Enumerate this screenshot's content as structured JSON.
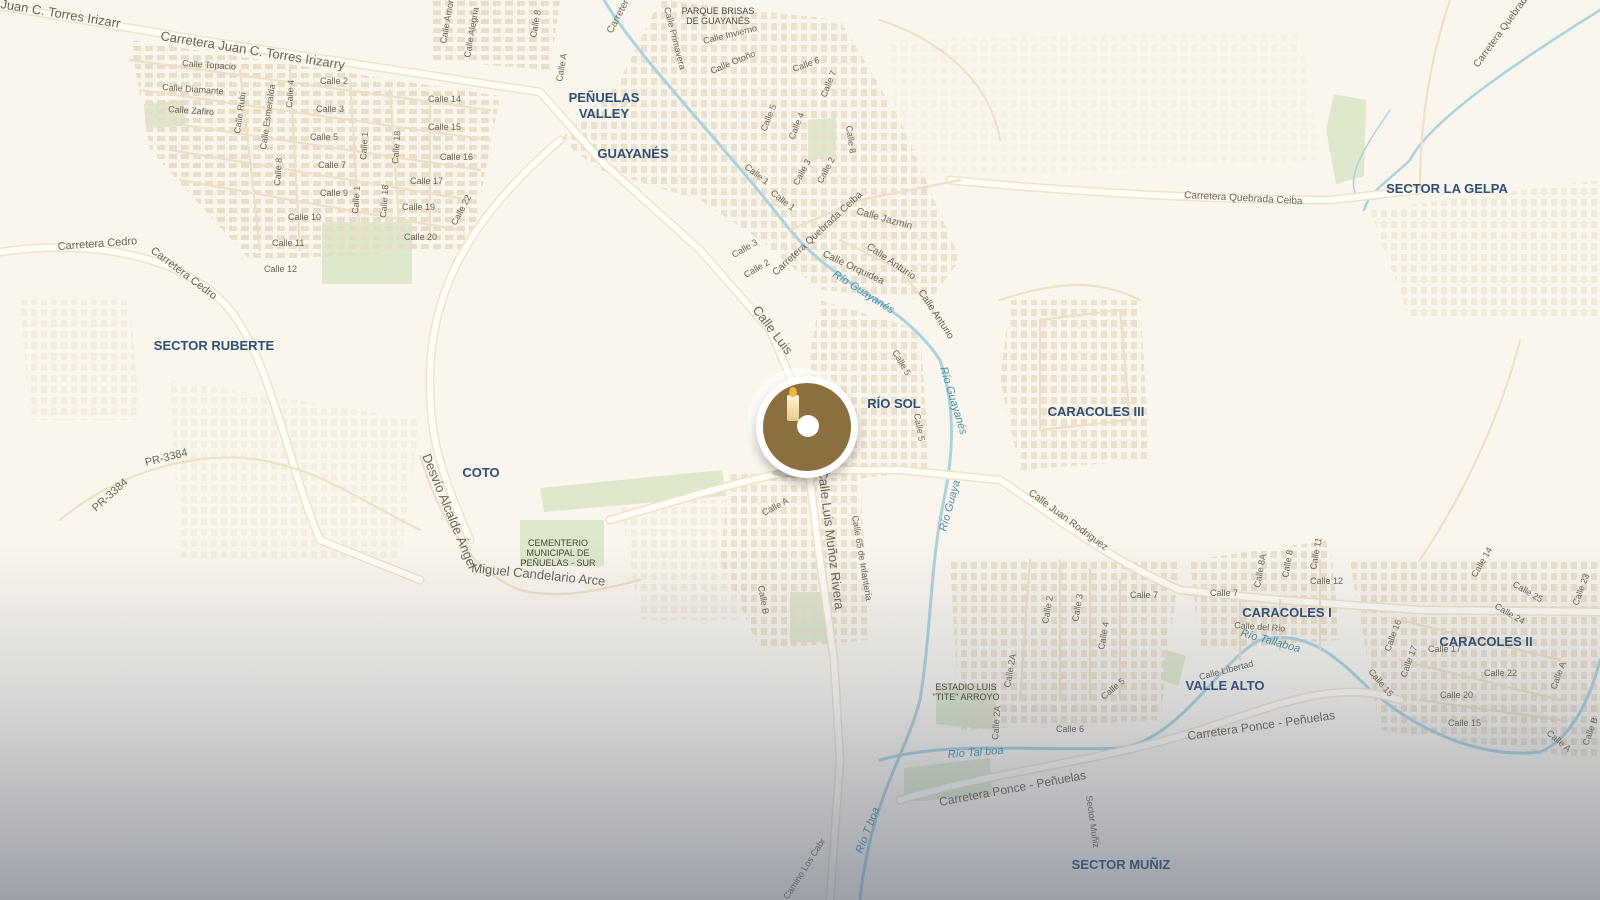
{
  "map": {
    "place_labels": [
      {
        "key": "penuelas_valley_1",
        "text": "PEÑUELAS"
      },
      {
        "key": "penuelas_valley_2",
        "text": "VALLEY"
      },
      {
        "key": "guayanes",
        "text": "GUAYANÉS"
      },
      {
        "key": "sector_ruberte",
        "text": "SECTOR RUBERTE"
      },
      {
        "key": "coto",
        "text": "COTO"
      },
      {
        "key": "rio_sol",
        "text": "RÍO SOL"
      },
      {
        "key": "caracoles_iii",
        "text": "CARACOLES III"
      },
      {
        "key": "sector_la_gelpa",
        "text": "SECTOR LA GELPA"
      },
      {
        "key": "caracoles_i",
        "text": "CARACOLES I"
      },
      {
        "key": "caracoles_ii",
        "text": "CARACOLES II"
      },
      {
        "key": "valle_alto",
        "text": "VALLE ALTO"
      },
      {
        "key": "sector_muniz",
        "text": "SECTOR MUÑIZ"
      }
    ],
    "poi_labels": {
      "parque_1": "PARQUE BRISAS",
      "parque_2": "DE GUAYANÉS",
      "cementerio_1": "CEMENTERIO",
      "cementerio_2": "MUNICIPAL DE",
      "cementerio_3": "PEÑUELAS - SUR",
      "estadio_1": "ESTADIO LUIS",
      "estadio_2": "\"TITE\" ARROYO"
    },
    "road_labels": {
      "torres_left": "Juan C. Torres Irizarry",
      "torres": "Carretera Juan C. Torres Irizarry",
      "cedro1": "Carretera Cedro",
      "cedro2": "Carretera Cedro",
      "pr3384a": "PR-3384",
      "pr3384b": "PR-3384",
      "desvio": "Desvío Alcalde Ángel Miguel Candelario Arce",
      "munoz_top": "Calle Luis M",
      "munoz": "Calle Luis Muñoz Rivera",
      "infanteria": "Calle 65 de Infantería",
      "quebrada_ceiba": "Carretera Quebrada Ceiba",
      "quebrada_ceiba2": "Carretera Quebrada Ceiba",
      "quebrada_ne": "Carretera Quebrada",
      "jazmin": "Calle Jazmin",
      "anturio": "Calle Anturio",
      "anturio2": "Calle Anturio",
      "orquidea": "Calle Orquidea",
      "primavera": "Calle Primavera",
      "invierno": "Calle Invierno",
      "otono": "Calle Otoño",
      "juan_rodriguez": "Calle Juan Rodriguez",
      "ponce1": "Carretera Ponce - Peñuelas",
      "ponce2": "Carretera Ponce - Peñuelas",
      "libertad": "Calle Libertad",
      "del_rio": "Calle del Rio",
      "los_cabros": "Camino Los Cabros",
      "sector_muniz_rd": "Sector Muñiz",
      "carretera_top": "Carretera",
      "topacio": "Calle Topacio",
      "diamante": "Calle Diamante",
      "zafiro": "Calle Zafiro",
      "rubi": "Calle Rubí",
      "esmeralda": "Calle Esmeralda",
      "c2": "Calle 2",
      "c3": "Calle 3",
      "c5": "Calle 5",
      "c7": "Calle 7",
      "c9": "Calle 9",
      "c10": "Calle 10",
      "c11": "Calle 11",
      "c12": "Calle 12",
      "c14": "Calle 14",
      "c15": "Calle 15",
      "c16": "Calle 16",
      "c17": "Calle 17",
      "c19": "Calle 19",
      "c20": "Calle 20",
      "c22": "Calle 22",
      "c18": "Calle 18",
      "c1": "Calle 1",
      "c4": "Calle 4",
      "c6": "Calle 6",
      "c8": "Calle 8",
      "amor": "Calle Amor",
      "alegria": "Calle Alegría",
      "cA": "Calle A",
      "cB": "Calle B",
      "cA2": "Calle A",
      "c6n": "Calle 6",
      "c7n": "Calle 7",
      "c5n": "Calle 5",
      "c4n": "Calle 4",
      "c3n": "Calle 3",
      "c2n": "Calle 2",
      "c1n": "Calle 1",
      "c8n": "Calle 8",
      "c3w": "Calle 3",
      "c2w": "Calle 2",
      "c5s": "Calle 5",
      "c5r": "Calle 5",
      "c2car": "Calle 2",
      "c3car": "Calle 3",
      "c4car": "Calle 4",
      "c5car": "Calle 5",
      "c6car": "Calle 6",
      "c2a": "Calle 2A",
      "c2a2": "Calle 2A",
      "c7car": "Calle 7",
      "c7car2": "Calle 7",
      "c8a": "Calle 8A",
      "c8car": "Calle 8",
      "c11car": "Calle 11",
      "c12car": "Calle 12",
      "c14e": "Calle 14",
      "c25e": "Calle 25",
      "c24e": "Calle 24",
      "c23e": "Calle 23",
      "c16e": "Calle 16",
      "c17e": "Calle 17",
      "c15e": "Calle 15",
      "c22e": "Calle 22",
      "c20e": "Calle 20",
      "c15e2": "Calle 15",
      "cAe": "Calle A",
      "cBe": "Calle B",
      "c1_2": "Calle 1"
    },
    "water_labels": {
      "guayanes1": "Río Guayanés",
      "guayanes2": "Río Guayanés",
      "guayanes3": "Río Guaya",
      "tallaboa1": "Río Tallaboa",
      "tallaboa2": "Río Tal  boa",
      "tallaboa3": "Río T  boa"
    },
    "marker": {
      "icon": "candle-icon"
    },
    "colors": {
      "land": "#faf6ee",
      "road": "#fffdf7",
      "road_casing": "#efe4cf",
      "building": "#e9dfcc",
      "park": "#dfe8cf",
      "water": "#a9d3df",
      "place_text": "#2d4e75",
      "road_text": "#6b6356",
      "water_text": "#4c8fa6",
      "marker": "#8c6f3e"
    }
  }
}
